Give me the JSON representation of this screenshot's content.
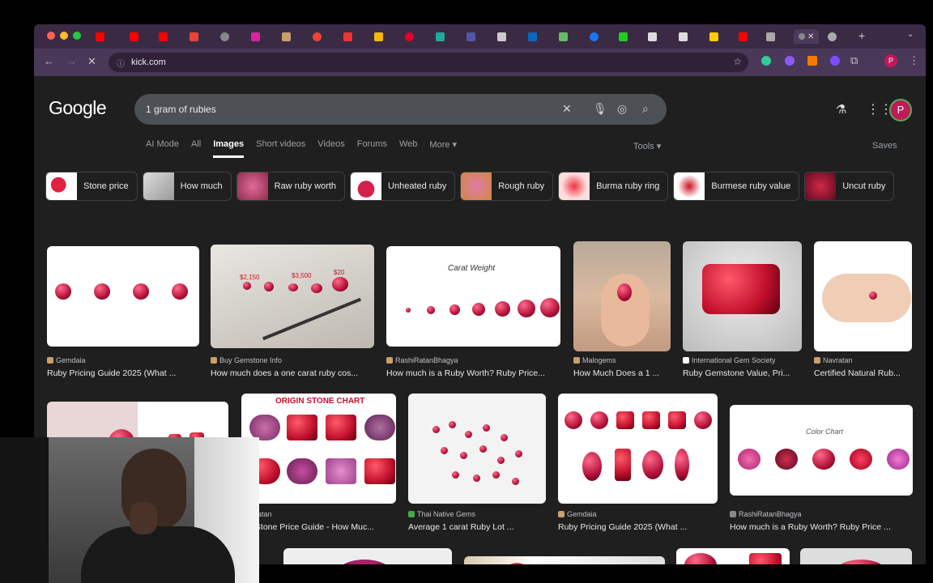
{
  "browser": {
    "url": "kick.com",
    "profile_initial": "P",
    "tab_close": "✕",
    "new_tab": "+",
    "accent": "#3a2a44"
  },
  "google": {
    "logo": "Google",
    "query": "1 gram of rubies",
    "profile_initial": "P",
    "filters": [
      "AI Mode",
      "All",
      "Images",
      "Short videos",
      "Videos",
      "Forums",
      "Web",
      "More ▾"
    ],
    "selected_filter": "Images",
    "tools": "Tools ▾",
    "saves": "Saves",
    "chips": [
      "Stone price",
      "How much",
      "Raw ruby worth",
      "Unheated ruby",
      "Rough ruby",
      "Burma ruby ring",
      "Burmese ruby value",
      "Uncut ruby"
    ]
  },
  "results_row1": [
    {
      "source": "Gemdaia",
      "title": "Ruby Pricing Guide 2025 (What ..."
    },
    {
      "source": "Buy Gemstone Info",
      "title": "How much does a one carat ruby cos..."
    },
    {
      "source": "RashiRatanBhagya",
      "title": "How much is a Ruby Worth? Ruby Price..."
    },
    {
      "source": "Malogems",
      "title": "How Much Does a 1 ..."
    },
    {
      "source": "International Gem Society",
      "title": "Ruby Gemstone Value, Pri..."
    },
    {
      "source": "Navratan",
      "title": "Certified Natural Rub..."
    }
  ],
  "results_row2": [
    {
      "source": "...avratan",
      "title": "...y Stone Price Guide - How Muc..."
    },
    {
      "source": "Thai Native Gems",
      "title": "Average 1 carat Ruby Lot ..."
    },
    {
      "source": "Gemdaia",
      "title": "Ruby Pricing Guide 2025 (What ..."
    },
    {
      "source": "RashiRatanBhagya",
      "title": "How much is a Ruby Worth? Ruby Price ..."
    }
  ],
  "image_text": {
    "carat_weight": "Carat Weight",
    "origin_stone_chart": "ORIGIN STONE CHART",
    "color_chart": "Color Chart",
    "prices": [
      "$2,150",
      "$3,500",
      "$20"
    ]
  }
}
